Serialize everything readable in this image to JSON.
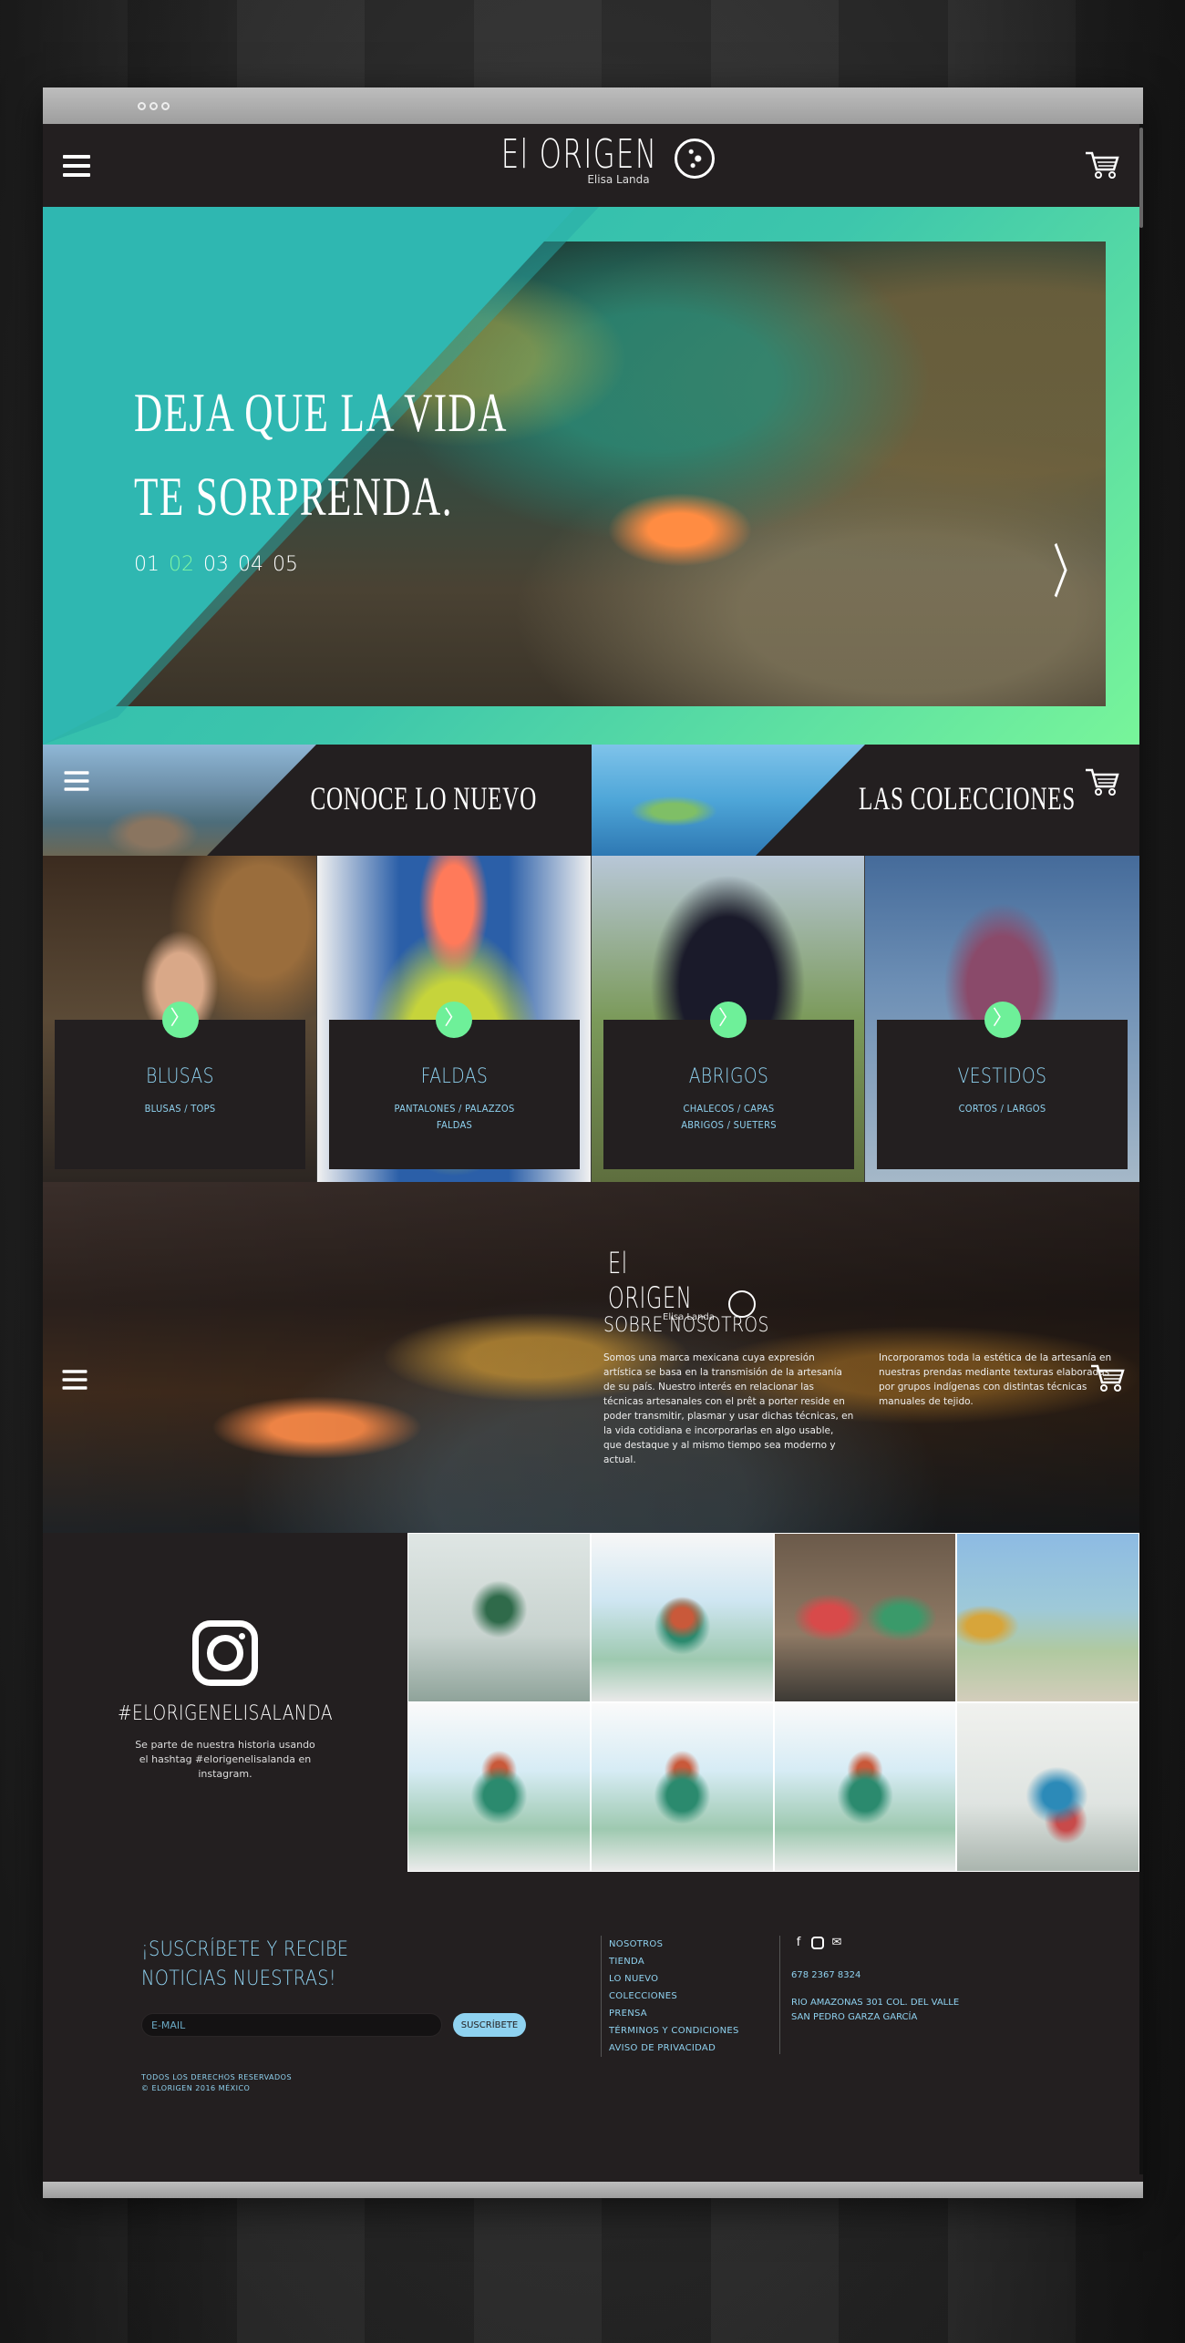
{
  "header": {
    "logo_word": "El ORIGEN",
    "logo_sub": "Elisa Landa"
  },
  "hero": {
    "title_line1": "DEJA QUE LA VIDA",
    "title_line2": "TE SORPRENDA.",
    "pages": [
      "01",
      "02",
      "03",
      "04",
      "05"
    ],
    "active_page": "02",
    "next_glyph": "〉"
  },
  "strip": {
    "new_label": "CONOCE LO NUEVO",
    "collections_label": "LAS COLECCIONES"
  },
  "categories": [
    {
      "name": "BLUSAS",
      "sub1": "BLUSAS / TOPS",
      "sub2": ""
    },
    {
      "name": "FALDAS",
      "sub1": "PANTALONES / PALAZZOS",
      "sub2": "FALDAS"
    },
    {
      "name": "ABRIGOS",
      "sub1": "CHALECOS / CAPAS",
      "sub2": "ABRIGOS / SUETERS"
    },
    {
      "name": "VESTIDOS",
      "sub1": "CORTOS / LARGOS",
      "sub2": ""
    }
  ],
  "about": {
    "logo_word": "El ORIGEN",
    "logo_sub": "Elisa Landa",
    "title": "SOBRE NOSOTROS",
    "paragraph1": "Somos una marca mexicana cuya expresión artística se basa en la transmisión de la artesanía de su país. Nuestro interés en relacionar las técnicas artesanales con el prêt a porter reside en poder transmitir, plasmar y usar dichas técnicas, en la vida cotidiana e incorporarlas en algo usable, que destaque y al mismo tiempo sea moderno y actual.",
    "paragraph2": "Incorporamos toda la estética de la artesanía en nuestras prendas mediante texturas elaboradas por grupos indígenas con distintas técnicas manuales de tejido."
  },
  "instagram": {
    "hashtag": "#ELORIGENELISALANDA",
    "text": "Se parte de nuestra historia usando el hashtag #elorigenelisalanda en instagram."
  },
  "footer": {
    "subscribe_title": "¡SUSCRÍBETE Y RECIBE NOTICIAS NUESTRAS!",
    "email_placeholder": "E-MAIL",
    "subscribe_button": "SUSCRÍBETE",
    "copyright_line1": "TODOS LOS DERECHOS RESERVADOS",
    "copyright_line2": "© ELORIGEN 2016 MÉXICO",
    "links": [
      "NOSOTROS",
      "TIENDA",
      "LO NUEVO",
      "COLECCIONES",
      "PRENSA",
      "TÉRMINOS Y CONDICIONES",
      "AVISO DE PRIVACIDAD"
    ],
    "phone": "678 2367 8324",
    "address_line1": "RIO AMAZONAS 301 COL. DEL VALLE",
    "address_line2": "SAN PEDRO GARZA GARCÍA"
  },
  "icons": [
    "hamburger-icon",
    "cart-icon",
    "chevron-right-icon",
    "instagram-icon",
    "facebook-icon",
    "mail-icon"
  ],
  "colors": {
    "background": "#231f20",
    "accent_blue": "#8fd2f0",
    "accent_green": "#6ef099",
    "hero_teal": "#2fb7b1"
  }
}
